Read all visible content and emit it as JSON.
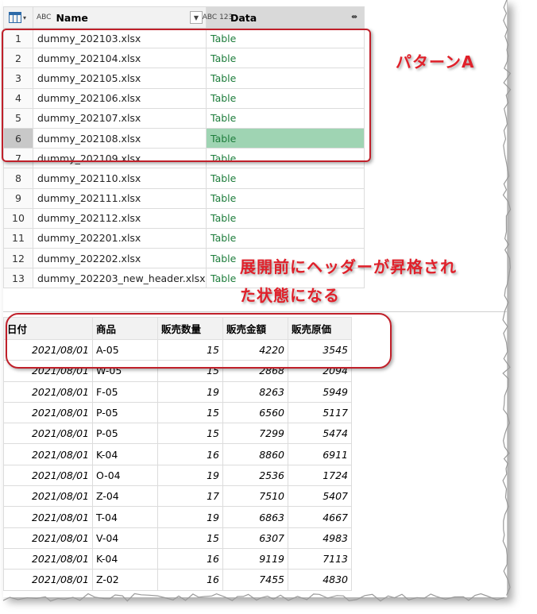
{
  "grid_top": {
    "columns": [
      {
        "label": "",
        "icon": "table-icon"
      },
      {
        "label": "Name",
        "type_icon": "ABC",
        "menu_icon": "chevron-down-icon"
      },
      {
        "label": "Data",
        "type_icon": "ABC 123",
        "menu_icon": "expand-icon"
      }
    ],
    "rows": [
      {
        "index": "1",
        "name": "dummy_202103.xlsx",
        "data": "Table"
      },
      {
        "index": "2",
        "name": "dummy_202104.xlsx",
        "data": "Table"
      },
      {
        "index": "3",
        "name": "dummy_202105.xlsx",
        "data": "Table"
      },
      {
        "index": "4",
        "name": "dummy_202106.xlsx",
        "data": "Table"
      },
      {
        "index": "5",
        "name": "dummy_202107.xlsx",
        "data": "Table"
      },
      {
        "index": "6",
        "name": "dummy_202108.xlsx",
        "data": "Table"
      },
      {
        "index": "7",
        "name": "dummy_202109.xlsx",
        "data": "Table"
      },
      {
        "index": "8",
        "name": "dummy_202110.xlsx",
        "data": "Table"
      },
      {
        "index": "9",
        "name": "dummy_202111.xlsx",
        "data": "Table"
      },
      {
        "index": "10",
        "name": "dummy_202112.xlsx",
        "data": "Table"
      },
      {
        "index": "11",
        "name": "dummy_202201.xlsx",
        "data": "Table"
      },
      {
        "index": "12",
        "name": "dummy_202202.xlsx",
        "data": "Table"
      },
      {
        "index": "13",
        "name": "dummy_202203_new_header.xlsx",
        "data": "Table"
      }
    ],
    "selected_row": "6",
    "selected_color": "#9fd4b3"
  },
  "grid_bottom": {
    "columns": [
      "日付",
      "商品",
      "販売数量",
      "販売金額",
      "販売原価"
    ],
    "rows": [
      [
        "2021/08/01",
        "A-05",
        "15",
        "4220",
        "3545"
      ],
      [
        "2021/08/01",
        "W-05",
        "15",
        "2868",
        "2094"
      ],
      [
        "2021/08/01",
        "F-05",
        "19",
        "8263",
        "5949"
      ],
      [
        "2021/08/01",
        "P-05",
        "15",
        "6560",
        "5117"
      ],
      [
        "2021/08/01",
        "P-05",
        "15",
        "7299",
        "5474"
      ],
      [
        "2021/08/01",
        "K-04",
        "16",
        "8860",
        "6911"
      ],
      [
        "2021/08/01",
        "O-04",
        "19",
        "2536",
        "1724"
      ],
      [
        "2021/08/01",
        "Z-04",
        "17",
        "7510",
        "5407"
      ],
      [
        "2021/08/01",
        "T-04",
        "19",
        "6863",
        "4667"
      ],
      [
        "2021/08/01",
        "V-04",
        "15",
        "6307",
        "4983"
      ],
      [
        "2021/08/01",
        "K-04",
        "16",
        "9119",
        "7113"
      ],
      [
        "2021/08/01",
        "Z-02",
        "16",
        "7455",
        "4830"
      ]
    ]
  },
  "annotations": {
    "pattern_label": "パターンA",
    "note_line1": "展開前にヘッダーが昇格され",
    "note_line2": "た状態になる",
    "color": "#e0202a"
  }
}
